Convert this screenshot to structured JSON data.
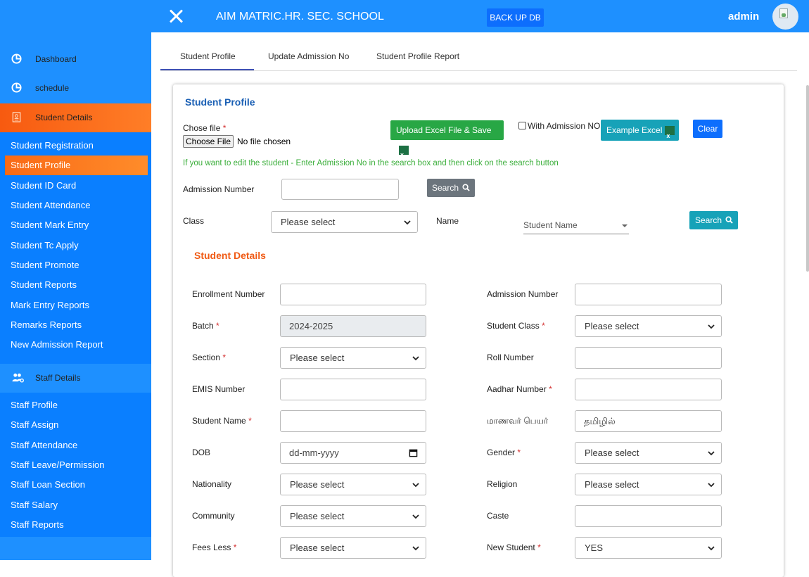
{
  "header": {
    "school_name": "AIM MATRIC.HR. SEC. SCHOOL",
    "backup_label": "BACK UP DB",
    "user": "admin"
  },
  "sidebar": {
    "dashboard": "Dashboard",
    "schedule": "schedule",
    "student_group": "Student Details",
    "student_items": [
      "Student Registration",
      "Student Profile",
      "Student ID Card",
      "Student Attendance",
      "Student Mark Entry",
      "Student Tc Apply",
      "Student Promote",
      "Student Reports",
      "Mark Entry Reports",
      "Remarks Reports",
      "New Admission Report"
    ],
    "staff_group": "Staff Details",
    "staff_items": [
      "Staff Profile",
      "Staff Assign",
      "Staff Attendance",
      "Staff Leave/Permission",
      "Staff Loan Section",
      "Staff Salary",
      "Staff Reports"
    ]
  },
  "tabs": [
    "Student Profile",
    "Update Admission No",
    "Student Profile Report"
  ],
  "profile": {
    "title": "Student Profile",
    "chose_file_label": "Chose file",
    "choose_file_button": "Choose File",
    "no_file_text": "No file chosen",
    "upload_button": "Upload Excel File & Save",
    "with_admission_label": "With Admission NO",
    "example_button": "Example Excel",
    "clear_button": "Clear",
    "hint": "If you want to edit the student - Enter Admission No in the search box and then click on the search button",
    "admission_label": "Admission Number",
    "search_label": "Search",
    "class_label": "Class",
    "class_placeholder": "Please select",
    "name_label": "Name",
    "name_placeholder": "Student Name",
    "search2_label": "Search"
  },
  "details": {
    "title": "Student Details",
    "enrollment_label": "Enrollment Number",
    "admission_label": "Admission Number",
    "batch_label": "Batch",
    "batch_value": "2024-2025",
    "student_class_label": "Student Class",
    "student_class_value": "Please select",
    "section_label": "Section",
    "section_value": "Please select",
    "roll_label": "Roll Number",
    "emis_label": "EMIS Number",
    "aadhar_label": "Aadhar Number",
    "student_name_label": "Student Name",
    "tamil_name_label": "மாணவர் பெயர்",
    "tamil_name_value": "தமிழில்",
    "dob_label": "DOB",
    "dob_placeholder": "dd-mm-yyyy",
    "gender_label": "Gender",
    "gender_value": "Please select",
    "nationality_label": "Nationality",
    "nationality_value": "Please select",
    "religion_label": "Religion",
    "religion_value": "Please select",
    "community_label": "Community",
    "community_value": "Please select",
    "caste_label": "Caste",
    "fees_label": "Fees Less",
    "fees_value": "Please select",
    "new_student_label": "New Student",
    "new_student_value": "YES"
  },
  "colors": {
    "primary": "#1e90ff",
    "accent_orange": "#f05a14",
    "success": "#28a745",
    "teal": "#17a2b8"
  }
}
